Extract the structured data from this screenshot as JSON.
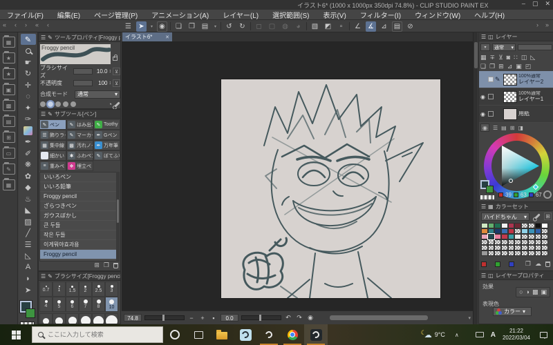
{
  "title_bar": {
    "title": "イラスト6* (1000 x 1000px 350dpi 74.8%) - CLIP STUDIO PAINT EX",
    "min": "–",
    "max": "▢",
    "close": "✕"
  },
  "menu_bar": {
    "items": [
      "ファイル(F)",
      "編集(E)",
      "ページ管理(P)",
      "アニメーション(A)",
      "レイヤー(L)",
      "選択範囲(S)",
      "表示(V)",
      "フィルター(I)",
      "ウィンドウ(W)",
      "ヘルプ(H)"
    ]
  },
  "toolbar": {
    "dock_arrows": [
      "«",
      "‹",
      "›",
      "«",
      "‹"
    ],
    "icons": [
      {
        "glyph": "☰",
        "state": "plain"
      },
      {
        "glyph": "➤",
        "state": "active"
      },
      {
        "glyph": "▾",
        "state": "tiny"
      },
      {
        "glyph": "◉",
        "state": "box"
      },
      {
        "glyph": "",
        "state": "sep"
      },
      {
        "glyph": "❏",
        "state": "plain"
      },
      {
        "glyph": "❐",
        "state": "plain"
      },
      {
        "glyph": "▤",
        "state": "plain"
      },
      {
        "glyph": "▾",
        "state": "tiny"
      },
      {
        "glyph": "",
        "state": "sep"
      },
      {
        "glyph": "↺",
        "state": "plain"
      },
      {
        "glyph": "↻",
        "state": "plain"
      },
      {
        "glyph": "",
        "state": "sep"
      },
      {
        "glyph": "◻",
        "state": "faded"
      },
      {
        "glyph": "▢",
        "state": "faded"
      },
      {
        "glyph": "◍",
        "state": "faded"
      },
      {
        "glyph": "◕",
        "state": "faded"
      },
      {
        "glyph": "",
        "state": "sep"
      },
      {
        "glyph": "▧",
        "state": "plain"
      },
      {
        "glyph": "◩",
        "state": "plain"
      },
      {
        "glyph": "▫",
        "state": "plain"
      },
      {
        "glyph": "",
        "state": "sep"
      },
      {
        "glyph": "∠",
        "state": "plain"
      },
      {
        "glyph": "∡",
        "state": "active"
      },
      {
        "glyph": "⊿",
        "state": "plain"
      },
      {
        "glyph": "▤",
        "state": "box"
      },
      {
        "glyph": "⊘",
        "state": "plain"
      }
    ],
    "right_arrows": [
      "›",
      "»"
    ]
  },
  "workspace": {
    "icons": [
      "▦",
      "★",
      "★",
      "▣",
      "▩",
      "▤",
      "⊞",
      "▭",
      "✎",
      "▦"
    ]
  },
  "tools": [
    {
      "glyph": "✎",
      "name": "pen-tool",
      "selected": true
    },
    {
      "css": "mag",
      "name": "zoom-tool"
    },
    {
      "glyph": "☛",
      "name": "hand-tool"
    },
    {
      "glyph": "↻",
      "name": "rotate-tool"
    },
    {
      "glyph": "✛",
      "name": "move-tool"
    },
    {
      "glyph": "◌",
      "name": "lasso-tool"
    },
    {
      "glyph": "✦",
      "name": "auto-select-tool"
    },
    {
      "glyph": "✑",
      "name": "eyedropper-tool"
    },
    {
      "css": "img",
      "name": "material-tool"
    },
    {
      "glyph": "✒",
      "name": "pen2-tool"
    },
    {
      "glyph": "✐",
      "name": "pencil-tool"
    },
    {
      "glyph": "❋",
      "name": "airbrush-tool"
    },
    {
      "glyph": "✿",
      "name": "decoration-tool"
    },
    {
      "glyph": "◆",
      "name": "eraser-tool"
    },
    {
      "glyph": "♨",
      "name": "blend-tool"
    },
    {
      "glyph": "◣",
      "name": "fill-tool"
    },
    {
      "glyph": "▨",
      "name": "gradient-tool"
    },
    {
      "glyph": "╱",
      "name": "figure-tool"
    },
    {
      "glyph": "☰",
      "name": "frame-border-tool"
    },
    {
      "glyph": "◺",
      "name": "ruler-tool"
    },
    {
      "glyph": "A",
      "name": "text-tool"
    },
    {
      "glyph": "◗",
      "name": "balloon-tool"
    },
    {
      "glyph": "➤",
      "name": "operation-tool"
    }
  ],
  "color": {
    "fg": "#273f43",
    "bg": "#3d9440"
  },
  "tool_property": {
    "header": "ツールプロパティ[Froggy pencil]",
    "brush_name": "Froggy pencil",
    "sliders": [
      {
        "label": "ブラシサイズ",
        "value": "10.0"
      },
      {
        "label": "不透明度",
        "value": "100"
      }
    ],
    "stepper": "↕",
    "source_btn": "⊻",
    "blend_label": "合成モード",
    "blend_value": "通常",
    "dd_arrow": "▾",
    "footer_icons": [
      "◔"
    ]
  },
  "sub_tool": {
    "header": "サブツール[ペン]",
    "tiles": [
      {
        "label": "ペン",
        "glyph": "✎",
        "selected": true
      },
      {
        "label": "はみ出さ",
        "glyph": "✎"
      },
      {
        "label": "Toothy",
        "glyph": "✎",
        "chip": "#3fae46"
      },
      {
        "label": "飾りライ",
        "glyph": "☰"
      },
      {
        "label": "マーカー",
        "glyph": "✎"
      },
      {
        "label": "Gペン",
        "glyph": "✒"
      },
      {
        "label": "集中線",
        "glyph": "▦"
      },
      {
        "label": "汚れノイ",
        "glyph": "▩"
      },
      {
        "label": "万年筆",
        "glyph": "✒",
        "chip": "#3a8fd0"
      },
      {
        "label": "細かいト",
        "glyph": "•",
        "chip": "#e4e8f0"
      },
      {
        "label": "ふわペン",
        "glyph": "✱"
      },
      {
        "label": "ぼてふち",
        "glyph": "✎"
      },
      {
        "label": "重みペ",
        "glyph": "≡"
      },
      {
        "label": "埋立ペ",
        "glyph": "❖",
        "chip": "#d03a8f"
      }
    ],
    "list": [
      {
        "label": "いいろペン"
      },
      {
        "label": "いいろ鉛筆"
      },
      {
        "label": "Froggy pencil"
      },
      {
        "label": "ざらつきペン"
      },
      {
        "label": "ガウスぼかし"
      },
      {
        "label": "큰 두들"
      },
      {
        "label": "작은 두들"
      },
      {
        "label": "이게뭐야효과용"
      },
      {
        "label": "Froggy pencil",
        "selected": true
      }
    ],
    "footer_icons": [
      "⊞",
      "❐"
    ]
  },
  "brush_size": {
    "header": "ブラシサイズ[Froggy pencil]",
    "cells": [
      {
        "label": "0.7",
        "dot": 2
      },
      {
        "label": "1",
        "dot": 2
      },
      {
        "label": "1.5",
        "dot": 3
      },
      {
        "label": "2",
        "dot": 3
      },
      {
        "label": "2.5",
        "dot": 4
      },
      {
        "label": "3",
        "dot": 4
      },
      {
        "label": "4",
        "dot": 4
      },
      {
        "label": "5",
        "dot": 5
      },
      {
        "label": "6",
        "dot": 5
      },
      {
        "label": "7",
        "dot": 6
      },
      {
        "label": "8",
        "dot": 6
      },
      {
        "label": "10",
        "dot": 7,
        "selected": true
      }
    ],
    "cells_partial": [
      {
        "dot": 9
      },
      {
        "dot": 11
      },
      {
        "dot": 12
      },
      {
        "dot": 14
      },
      {
        "dot": 15
      },
      {
        "dot": 17
      }
    ]
  },
  "canvas": {
    "tab": "イラスト6*",
    "close": "✕"
  },
  "status_bar": {
    "zoom": "74.8",
    "minus": "−",
    "plus": "+",
    "fit": "▪",
    "rotation": "0.0",
    "rot_left": "↶",
    "rot_right": "↷",
    "rot_reset": "◉",
    "corner": "▾"
  },
  "layer_panel": {
    "tab": "レイヤー",
    "blend": "通常",
    "toolbar_row1": [
      "▦",
      "∓",
      "⊻",
      "◙",
      "∷",
      "◫",
      "◺"
    ],
    "toolbar_row2": [
      "❏",
      "❐",
      "⊞",
      "⊿",
      "▣",
      "◰"
    ],
    "layers": [
      {
        "info": "100%通常",
        "name": "レイヤー2",
        "selected": true,
        "edit": true,
        "eye": false,
        "thumb": "checker"
      },
      {
        "info": "100%通常",
        "name": "レイヤー1",
        "eye": true,
        "thumb": "checker"
      },
      {
        "info": "",
        "name": "用紙",
        "eye": true,
        "thumb": "paper"
      }
    ]
  },
  "color_panel": {
    "tabs": [
      "☰",
      "▤",
      "⊞",
      "◨"
    ],
    "active_tab": "◉",
    "r": "39",
    "g": "63",
    "b": "67"
  },
  "color_set": {
    "tab": "カラーセット",
    "set_name": "ハイドちゃん",
    "dd_arrow": "▾",
    "selected_index": 21,
    "swatches": [
      "#cfe8c2",
      "#63b06e",
      "#1f6f52",
      "#f2f2f2",
      "#ad3550",
      "#6e2833",
      null,
      null,
      "#121212",
      "#ffffff",
      "#e08a3c",
      "#2f8087",
      "#1b3a69",
      "#3a70b2",
      "#c03345",
      null,
      "#8fd2e8",
      "#3a93b8",
      "#2f5fa9",
      null,
      "#eaa6ba",
      "#214950",
      "#e87f9f",
      "#c23a4d",
      "#39a0a6",
      "#e8e8e8",
      null,
      null,
      null,
      null,
      null,
      null,
      null,
      null,
      null,
      null,
      null,
      null,
      null,
      null,
      null,
      null,
      null,
      null,
      null,
      null,
      null,
      null,
      null,
      null,
      "#9a9a9a",
      null,
      null,
      null,
      null,
      null,
      null,
      null,
      null,
      null
    ],
    "footer_swatches": [
      "#c03030",
      "#30a030",
      "#3040c0"
    ],
    "footer_icons": [
      "❐",
      "☁"
    ]
  },
  "layer_property": {
    "tab": "レイヤープロパティ",
    "effect_label": "効果",
    "effect_icons": [
      "○",
      "◑",
      "▩",
      "▣"
    ],
    "expr_label": "表現色",
    "color_mode": "カラー",
    "dd_arrow": "▾"
  },
  "taskbar": {
    "search_placeholder": "ここに入力して検索",
    "weather_temp": "9°C",
    "tray_chevron": "∧",
    "ime": "A",
    "time": "21:22",
    "date": "2022/03/04"
  }
}
